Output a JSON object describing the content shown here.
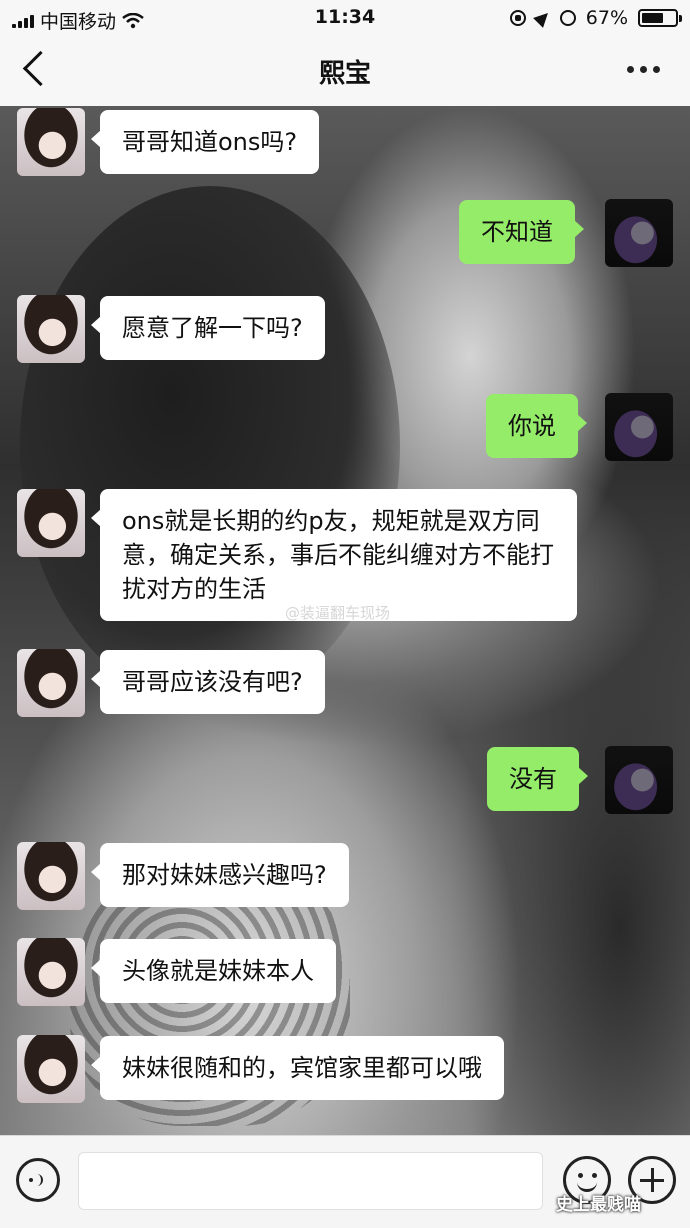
{
  "status_bar": {
    "carrier": "中国移动",
    "time": "11:34",
    "battery": "67%",
    "battery_level": 0.67
  },
  "nav": {
    "title": "熙宝"
  },
  "messages": [
    {
      "from": "contact",
      "text": "哥哥知道ons吗?"
    },
    {
      "from": "me",
      "text": "不知道"
    },
    {
      "from": "contact",
      "text": "愿意了解一下吗?"
    },
    {
      "from": "me",
      "text": "你说"
    },
    {
      "from": "contact",
      "text": "ons就是长期的约p友，规矩就是双方同意，确定关系，事后不能纠缠对方不能打扰对方的生活"
    },
    {
      "from": "contact",
      "text": "哥哥应该没有吧?"
    },
    {
      "from": "me",
      "text": "没有"
    },
    {
      "from": "contact",
      "text": "那对妹妹感兴趣吗?"
    },
    {
      "from": "contact",
      "text": "头像就是妹妹本人"
    },
    {
      "from": "contact",
      "text": "妹妹很随和的，宾馆家里都可以哦"
    }
  ],
  "watermark": "@装逼翻车现场",
  "brand_mark": "史上最贱喵",
  "icons": {
    "back": "chevron-left-icon",
    "more": "more-dots-icon",
    "voice": "voice-icon",
    "emoji": "emoji-icon",
    "plus": "plus-icon"
  },
  "colors": {
    "incoming_bubble": "#ffffff",
    "outgoing_bubble": "#95ec69"
  }
}
